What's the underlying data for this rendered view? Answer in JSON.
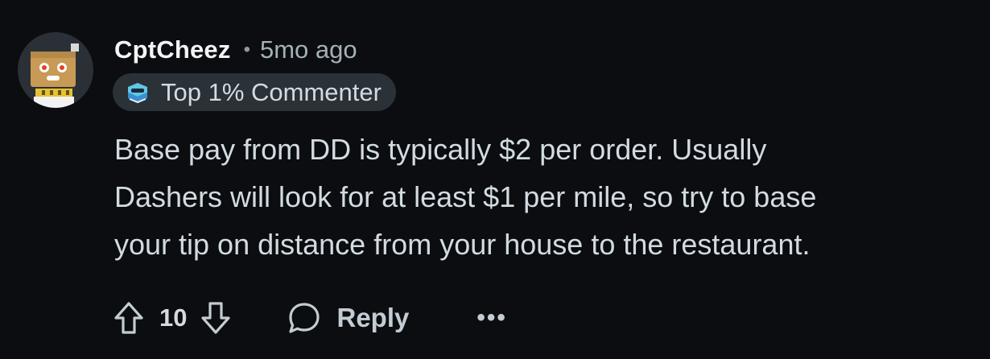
{
  "comment": {
    "author": "CptCheez",
    "separator": "•",
    "time_ago": "5mo ago",
    "flair": {
      "icon": "commenter-badge-icon",
      "label": "Top 1% Commenter"
    },
    "body_lines": [
      "Base pay from DD is typically $2 per order. Usually",
      "Dashers will look for at least $1 per mile, so try to base",
      "your tip on distance from your house to the restaurant."
    ],
    "actions": {
      "upvote_icon": "arrow-up-icon",
      "vote_count": "10",
      "downvote_icon": "arrow-down-icon",
      "reply_icon": "speech-bubble-icon",
      "reply_label": "Reply",
      "more_label": "•••"
    }
  },
  "colors": {
    "background": "#0b0d10",
    "text": "#d2dbe1",
    "muted": "#a5b0b8",
    "badge_bg": "#2a3137"
  }
}
